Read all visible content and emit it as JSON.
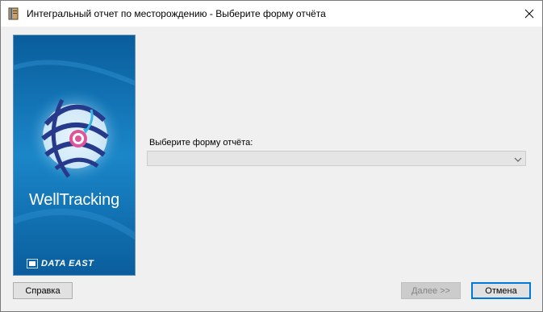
{
  "window": {
    "title": "Интегральный отчет по месторождению - Выберите форму отчёта",
    "icon": "book-icon",
    "close_icon": "close-icon"
  },
  "banner": {
    "brand": "WellTracking",
    "logo": "DATA EAST",
    "background_color": "#0b67a8"
  },
  "form": {
    "label": "Выберите форму отчёта:",
    "selected_value": ""
  },
  "buttons": {
    "help": "Справка",
    "next": "Далее >>",
    "cancel": "Отмена"
  },
  "colors": {
    "accent": "#0078d7",
    "disabled_text": "#838383"
  }
}
